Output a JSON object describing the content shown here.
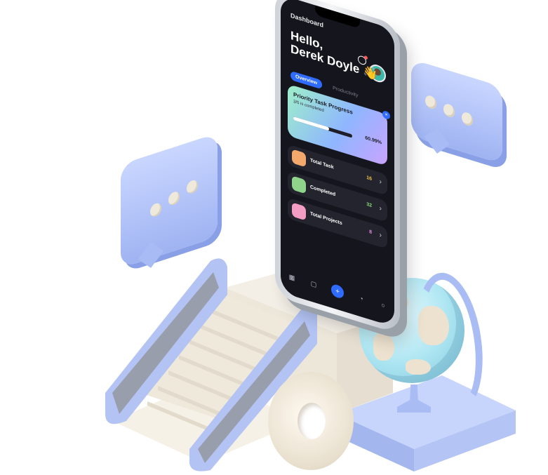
{
  "app": {
    "screen_title": "Dashboard",
    "greeting_line1": "Hello,",
    "greeting_line2": "Derek Doyle",
    "wave_emoji": "👋"
  },
  "tabs": [
    {
      "label": "Overview",
      "active": true
    },
    {
      "label": "Productivity",
      "active": false
    }
  ],
  "priority_card": {
    "title": "Priority Task Progress",
    "subtitle": "3/5 is completed",
    "percent_label": "60.99%",
    "progress_fraction": 0.6099
  },
  "stats": [
    {
      "label": "Total Task",
      "value": "16",
      "icon": "paintbrush-icon",
      "icon_color": "#f3a96b",
      "value_color": "#f5c542"
    },
    {
      "label": "Completed",
      "value": "32",
      "icon": "check-icon",
      "icon_color": "#8fd48a",
      "value_color": "#8fe07a"
    },
    {
      "label": "Total Projects",
      "value": "8",
      "icon": "warning-icon",
      "icon_color": "#f39cc4",
      "value_color": "#e58fe0"
    }
  ],
  "nav": {
    "items": [
      "grid-icon",
      "calendar-icon",
      "add-icon",
      "bell-icon",
      "profile-icon"
    ]
  },
  "colors": {
    "accent": "#2f6bff",
    "bubble": "#a9bcf4",
    "cream": "#efe9dc"
  }
}
